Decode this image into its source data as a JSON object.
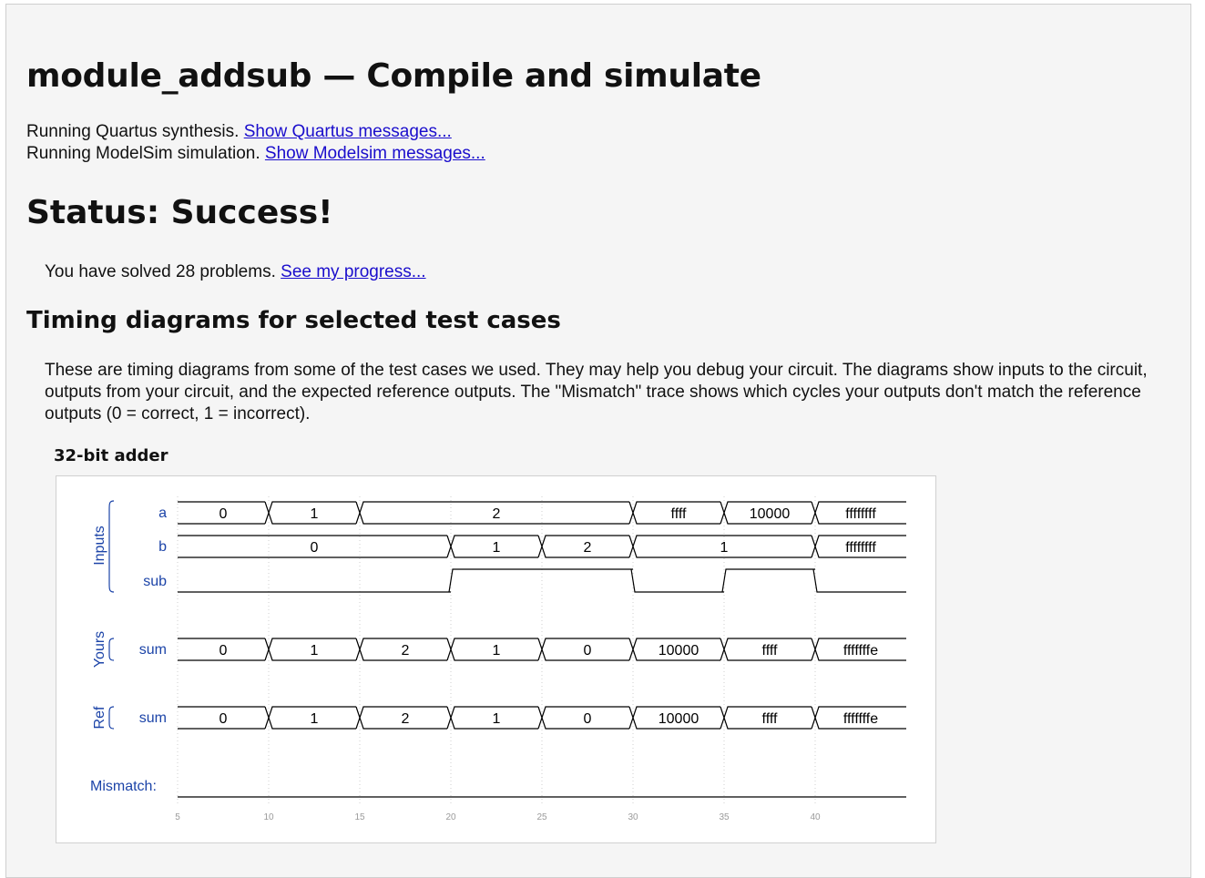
{
  "page": {
    "title": "module_addsub — Compile and simulate",
    "quartus_text": "Running Quartus synthesis.",
    "quartus_link": "Show Quartus messages...",
    "modelsim_text": "Running ModelSim simulation.",
    "modelsim_link": "Show Modelsim messages...",
    "status": "Status: Success!",
    "solved_text": "You have solved 28 problems.",
    "progress_link": "See my progress...",
    "timing_heading": "Timing diagrams for selected test cases",
    "description": "These are timing diagrams from some of the test cases we used. They may help you debug your circuit. The diagrams show inputs to the circuit, outputs from your circuit, and the expected reference outputs. The \"Mismatch\" trace shows which cycles your outputs don't match the reference outputs (0 = correct, 1 = incorrect).",
    "diagram_title": "32-bit adder"
  },
  "timing": {
    "groups": [
      {
        "label": "Inputs",
        "signals": [
          "a",
          "b",
          "sub"
        ]
      },
      {
        "label": "Yours",
        "signals": [
          "sum"
        ]
      },
      {
        "label": "Ref",
        "signals": [
          "sum"
        ]
      }
    ],
    "mismatch_label": "Mismatch:",
    "time_ticks": [
      "5",
      "10",
      "15",
      "20",
      "25",
      "30",
      "35",
      "40"
    ],
    "time_range": [
      5,
      45
    ],
    "signals": {
      "a": [
        {
          "t0": 5,
          "t1": 10,
          "v": "0"
        },
        {
          "t0": 10,
          "t1": 15,
          "v": "1"
        },
        {
          "t0": 15,
          "t1": 30,
          "v": "2"
        },
        {
          "t0": 30,
          "t1": 35,
          "v": "ffff"
        },
        {
          "t0": 35,
          "t1": 40,
          "v": "10000"
        },
        {
          "t0": 40,
          "t1": 45,
          "v": "ffffffff"
        }
      ],
      "b": [
        {
          "t0": 5,
          "t1": 20,
          "v": "0"
        },
        {
          "t0": 20,
          "t1": 25,
          "v": "1"
        },
        {
          "t0": 25,
          "t1": 30,
          "v": "2"
        },
        {
          "t0": 30,
          "t1": 40,
          "v": "1"
        },
        {
          "t0": 40,
          "t1": 45,
          "v": "ffffffff"
        }
      ],
      "sub": [
        {
          "t": 5,
          "level": 0
        },
        {
          "t": 20,
          "level": 1
        },
        {
          "t": 30,
          "level": 0
        },
        {
          "t": 35,
          "level": 1
        },
        {
          "t": 40,
          "level": 0
        }
      ],
      "yours_sum": [
        {
          "t0": 5,
          "t1": 10,
          "v": "0"
        },
        {
          "t0": 10,
          "t1": 15,
          "v": "1"
        },
        {
          "t0": 15,
          "t1": 20,
          "v": "2"
        },
        {
          "t0": 20,
          "t1": 25,
          "v": "1"
        },
        {
          "t0": 25,
          "t1": 30,
          "v": "0"
        },
        {
          "t0": 30,
          "t1": 35,
          "v": "10000"
        },
        {
          "t0": 35,
          "t1": 40,
          "v": "ffff"
        },
        {
          "t0": 40,
          "t1": 45,
          "v": "fffffffe"
        }
      ],
      "ref_sum": [
        {
          "t0": 5,
          "t1": 10,
          "v": "0"
        },
        {
          "t0": 10,
          "t1": 15,
          "v": "1"
        },
        {
          "t0": 15,
          "t1": 20,
          "v": "2"
        },
        {
          "t0": 20,
          "t1": 25,
          "v": "1"
        },
        {
          "t0": 25,
          "t1": 30,
          "v": "0"
        },
        {
          "t0": 30,
          "t1": 35,
          "v": "10000"
        },
        {
          "t0": 35,
          "t1": 40,
          "v": "ffff"
        },
        {
          "t0": 40,
          "t1": 45,
          "v": "fffffffe"
        }
      ],
      "mismatch": [
        {
          "t": 5,
          "level": 0
        }
      ]
    },
    "colors": {
      "label": "#1c44a8",
      "trace": "#000000",
      "grid": "#cfcfcf",
      "tick": "#9a9a9a"
    }
  }
}
